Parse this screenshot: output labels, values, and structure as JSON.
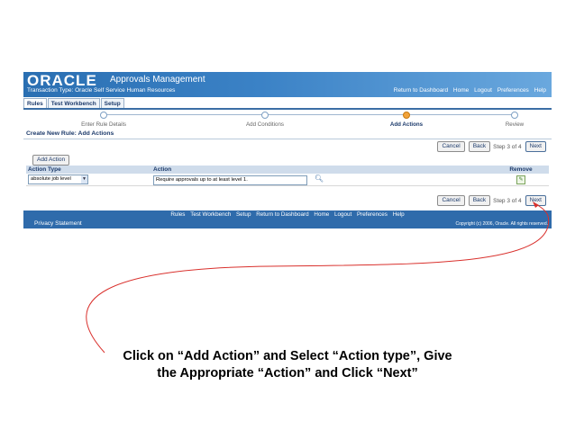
{
  "header": {
    "logo": "ORACLE",
    "app_name": "Approvals Management",
    "transaction_type": "Transaction Type: Oracle Self Service Human Resources",
    "global_links": [
      "Return to Dashboard",
      "Home",
      "Logout",
      "Preferences",
      "Help"
    ]
  },
  "tabs": [
    {
      "label": "Rules",
      "active": true
    },
    {
      "label": "Test Workbench",
      "active": false
    },
    {
      "label": "Setup",
      "active": false
    }
  ],
  "train": {
    "steps": [
      "Enter Rule Details",
      "Add Conditions",
      "Add Actions",
      "Review"
    ],
    "current_index": 2
  },
  "page_title": "Create New Rule: Add Actions",
  "nav_buttons": {
    "cancel": "Cancel",
    "back": "Back",
    "step_text": "Step 3 of 4",
    "next": "Next"
  },
  "add_action_label": "Add Action",
  "table": {
    "columns": [
      "Action Type",
      "Action",
      "Remove"
    ],
    "rows": [
      {
        "action_type": "absolute job level",
        "action": "Require approvals up to at least level 1."
      }
    ]
  },
  "footer": {
    "links": [
      "Rules",
      "Test Workbench",
      "Setup",
      "Return to Dashboard",
      "Home",
      "Logout",
      "Preferences",
      "Help"
    ],
    "privacy": "Privacy Statement",
    "copyright": "Copyright (c) 2006, Oracle. All rights reserved."
  },
  "instruction": {
    "line1": "Click on “Add Action” and Select “Action type”, Give",
    "line2": "the Appropriate “Action” and Click “Next”"
  },
  "colors": {
    "brand_blue": "#2f6bab",
    "annotation_red": "#d9302c",
    "current_step": "#f2a33a"
  }
}
